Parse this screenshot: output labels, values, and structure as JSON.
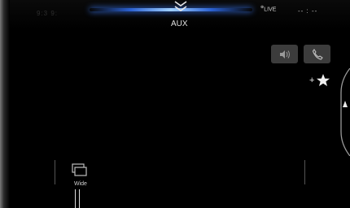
{
  "status": {
    "left_text": "9:3 9:",
    "live": "LIVE",
    "clock": "-- : --"
  },
  "source": "AUX",
  "controls": {
    "volume_icon": "speaker-icon",
    "phone_icon": "phone-icon",
    "favorite_plus": "+"
  },
  "bottom": {
    "wide_label": "Wide",
    "wide_icon": "screen-mode-icon"
  },
  "colors": {
    "accent": "#2a60d0",
    "button_bg": "#3c3c3c"
  }
}
